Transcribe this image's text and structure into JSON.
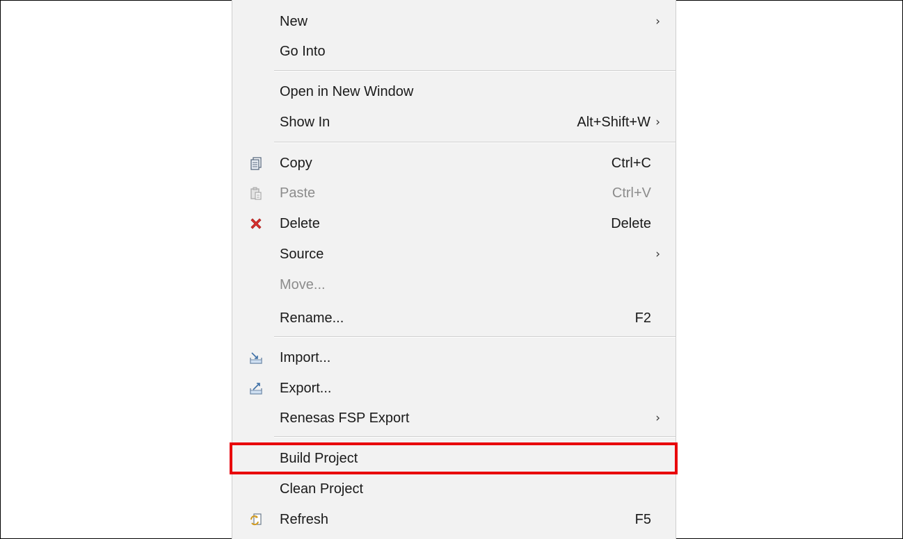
{
  "menu": {
    "new": {
      "label": "New",
      "arrow": "›"
    },
    "go_into": {
      "label": "Go Into"
    },
    "open_new_window": {
      "label": "Open in New Window"
    },
    "show_in": {
      "label": "Show In",
      "shortcut": "Alt+Shift+W",
      "arrow": "›"
    },
    "copy": {
      "label": "Copy",
      "shortcut": "Ctrl+C",
      "icon": "copy-icon"
    },
    "paste": {
      "label": "Paste",
      "shortcut": "Ctrl+V",
      "icon": "paste-icon",
      "disabled": true
    },
    "delete": {
      "label": "Delete",
      "shortcut": "Delete",
      "icon": "delete-icon"
    },
    "source": {
      "label": "Source",
      "arrow": "›"
    },
    "move": {
      "label": "Move...",
      "disabled": true
    },
    "rename": {
      "label": "Rename...",
      "shortcut": "F2"
    },
    "import": {
      "label": "Import...",
      "icon": "import-icon"
    },
    "export": {
      "label": "Export...",
      "icon": "export-icon"
    },
    "renesas_fsp_export": {
      "label": "Renesas FSP Export",
      "arrow": "›"
    },
    "build_project": {
      "label": "Build Project",
      "highlighted": true
    },
    "clean_project": {
      "label": "Clean Project"
    },
    "refresh": {
      "label": "Refresh",
      "shortcut": "F5",
      "icon": "refresh-icon"
    }
  },
  "colors": {
    "menu_background": "#f2f2f2",
    "highlight_border": "#e8000b",
    "disabled_text": "#8c8c8c",
    "delete_icon": "#d9322f"
  }
}
